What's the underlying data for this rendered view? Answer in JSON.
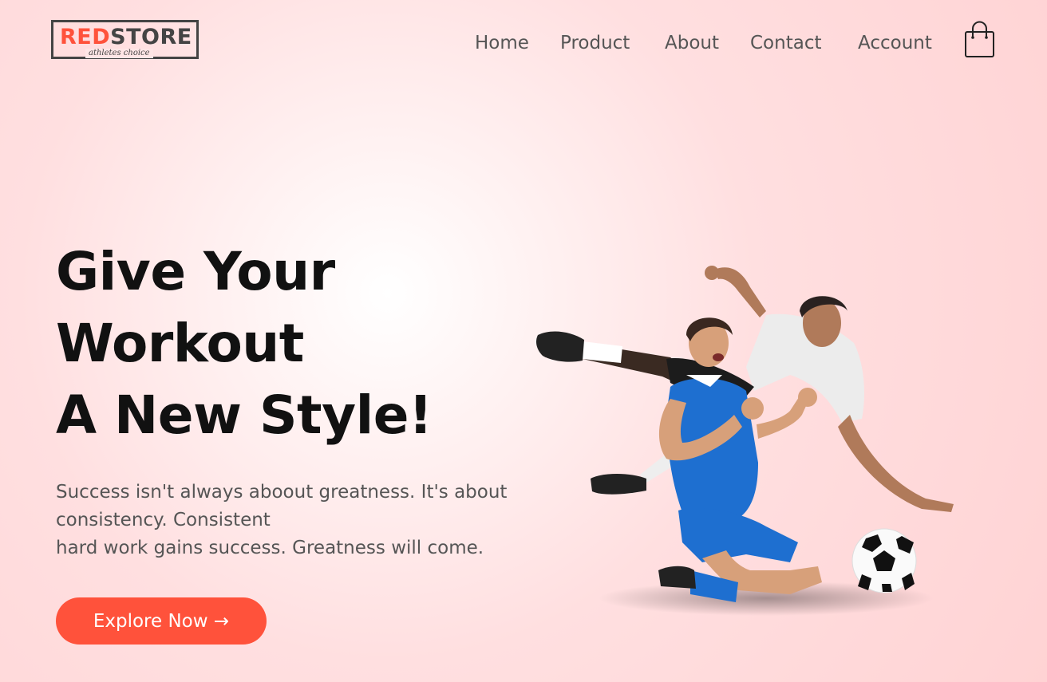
{
  "header": {
    "logo": {
      "part1": "RED",
      "part2": "STORE",
      "tagline": "athletes choice"
    },
    "nav": [
      {
        "label": "Home"
      },
      {
        "label": "Product"
      },
      {
        "label": "About"
      },
      {
        "label": "Contact"
      },
      {
        "label": "Account"
      }
    ],
    "cart_icon": "shopping-bag-icon"
  },
  "hero": {
    "title_lines": [
      "Give Your",
      "Workout",
      "A New Style!"
    ],
    "subtitle_lines": [
      "Success isn't always aboout greatness. It's about",
      "consistency. Consistent",
      "hard work gains success. Greatness will come."
    ],
    "cta_label": "Explore Now →",
    "image": "football-players-photo"
  },
  "colors": {
    "accent": "#ff523b",
    "text_dark": "#111111",
    "text_body": "#555555",
    "background": "#ffd6d6"
  }
}
